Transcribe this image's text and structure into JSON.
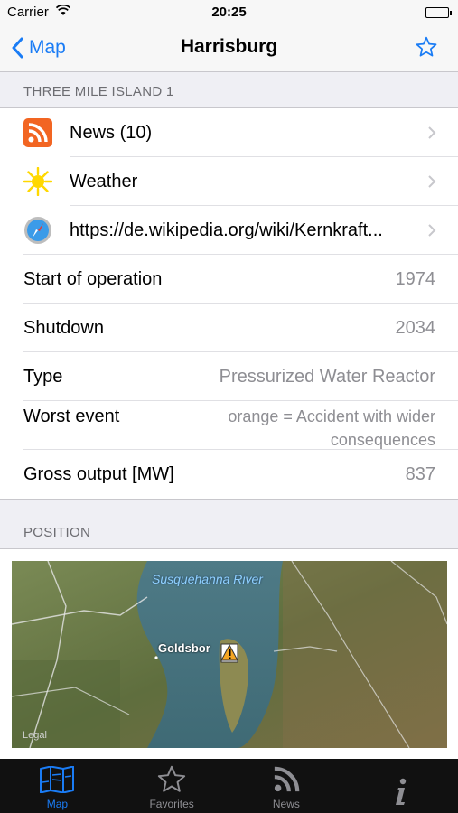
{
  "status_bar": {
    "carrier": "Carrier",
    "time": "20:25"
  },
  "nav": {
    "back_label": "Map",
    "title": "Harrisburg"
  },
  "section_plant": {
    "header": "THREE MILE ISLAND 1"
  },
  "links": [
    {
      "label": "News (10)",
      "icon": "rss-icon"
    },
    {
      "label": "Weather",
      "icon": "sun-icon"
    },
    {
      "label": "https://de.wikipedia.org/wiki/Kernkraft...",
      "icon": "safari-compass-icon"
    }
  ],
  "details": [
    {
      "label": "Start of operation",
      "value": "1974"
    },
    {
      "label": "Shutdown",
      "value": "2034"
    },
    {
      "label": "Type",
      "value": "Pressurized Water Reactor"
    },
    {
      "label": "Worst event",
      "value": "orange = Accident with wider consequences"
    },
    {
      "label": "Gross output [MW]",
      "value": "837"
    }
  ],
  "section_position": {
    "header": "POSITION"
  },
  "map": {
    "river_label": "Susquehanna River",
    "town_label": "Goldsbor",
    "legal": "Legal"
  },
  "tabs": [
    {
      "label": "Map",
      "active": true
    },
    {
      "label": "Favorites",
      "active": false
    },
    {
      "label": "News",
      "active": false
    },
    {
      "label": "",
      "active": false
    }
  ],
  "colors": {
    "accent": "#1a7cf5",
    "tab_bar": "#111111",
    "warning_orange": "#f5a623"
  }
}
